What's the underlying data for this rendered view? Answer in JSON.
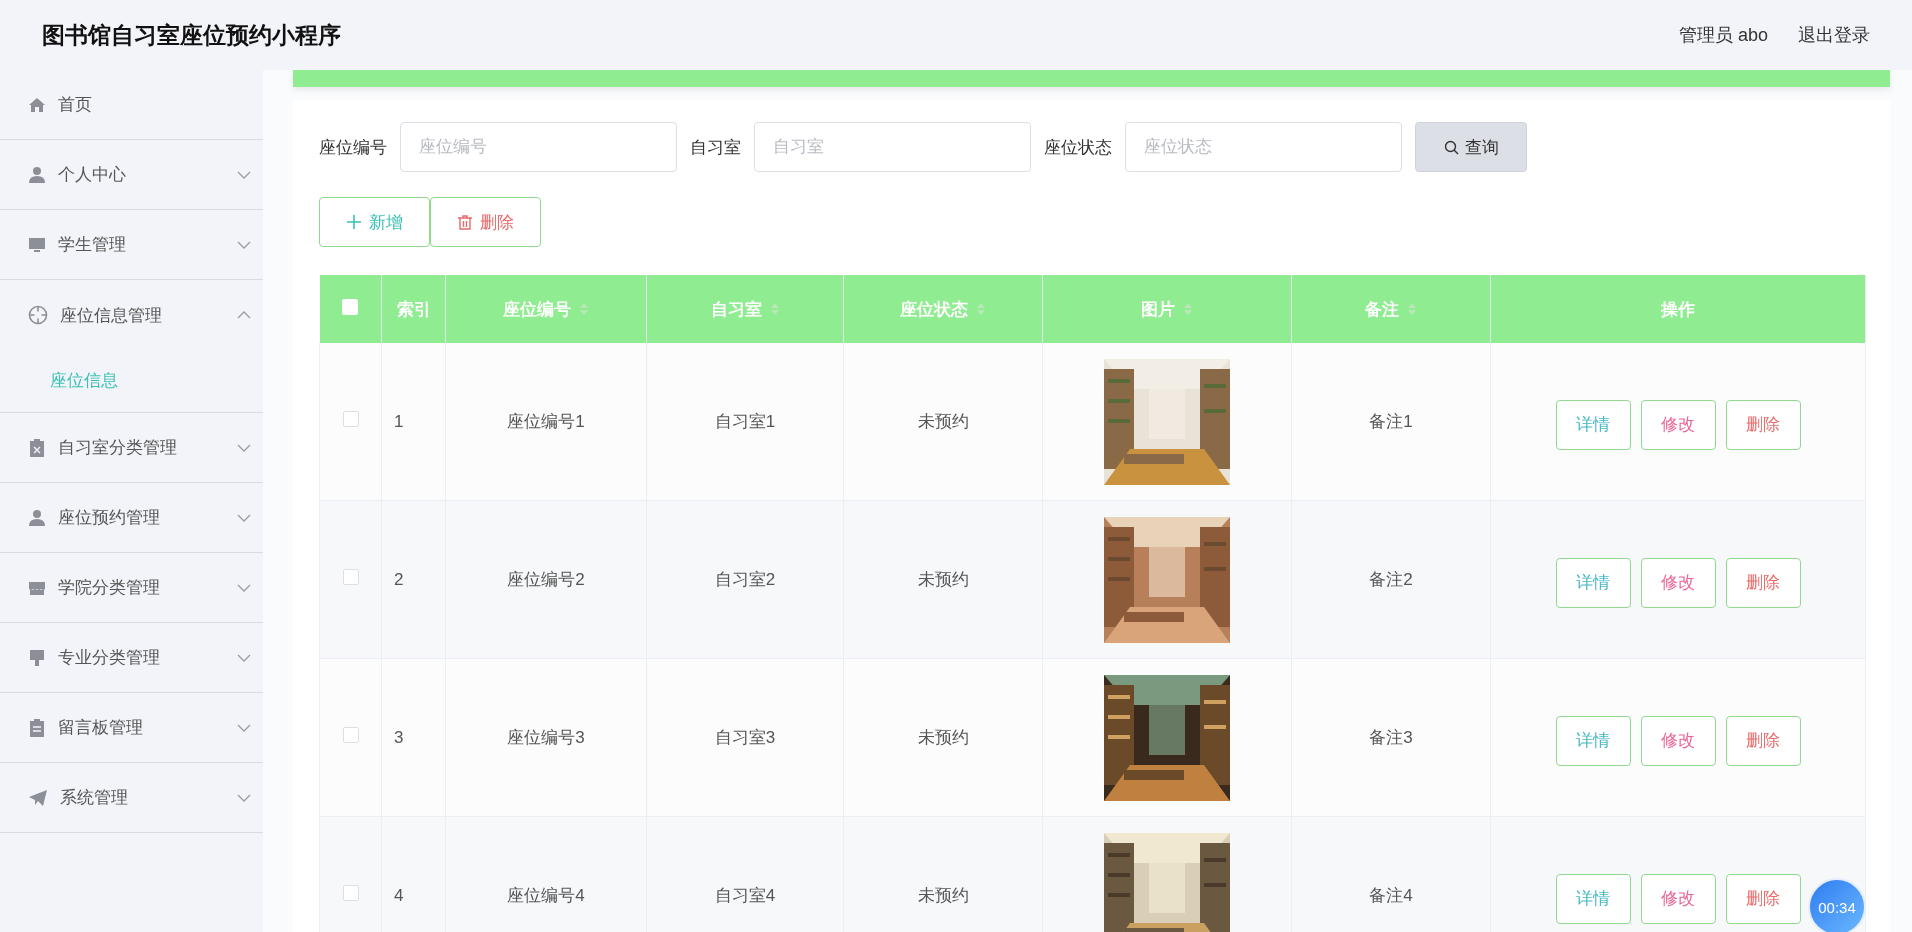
{
  "header": {
    "title": "图书馆自习室座位预约小程序",
    "user": "管理员 abo",
    "logout": "退出登录"
  },
  "sidebar": {
    "items": [
      {
        "label": "首页",
        "kind": "link"
      },
      {
        "label": "个人中心",
        "kind": "submenu",
        "expanded": false
      },
      {
        "label": "学生管理",
        "kind": "submenu",
        "expanded": false
      },
      {
        "label": "座位信息管理",
        "kind": "submenu",
        "expanded": true,
        "children": [
          {
            "label": "座位信息",
            "selected": true
          }
        ]
      },
      {
        "label": "自习室分类管理",
        "kind": "submenu",
        "expanded": false
      },
      {
        "label": "座位预约管理",
        "kind": "submenu",
        "expanded": false
      },
      {
        "label": "学院分类管理",
        "kind": "submenu",
        "expanded": false
      },
      {
        "label": "专业分类管理",
        "kind": "submenu",
        "expanded": false
      },
      {
        "label": "留言板管理",
        "kind": "submenu",
        "expanded": false
      },
      {
        "label": "系统管理",
        "kind": "submenu",
        "expanded": false
      }
    ]
  },
  "search": {
    "fields": [
      {
        "label": "座位编号",
        "placeholder": "座位编号"
      },
      {
        "label": "自习室",
        "placeholder": "自习室"
      },
      {
        "label": "座位状态",
        "placeholder": "座位状态"
      }
    ],
    "button": "查询"
  },
  "actions": [
    {
      "label": "新增",
      "kind": "add"
    },
    {
      "label": "删除",
      "kind": "delete"
    }
  ],
  "table": {
    "select_all": {
      "checked": false
    },
    "columns": [
      {
        "label": "索引",
        "sortable": false
      },
      {
        "label": "座位编号",
        "sortable": true
      },
      {
        "label": "自习室",
        "sortable": true
      },
      {
        "label": "座位状态",
        "sortable": true
      },
      {
        "label": "图片",
        "sortable": true
      },
      {
        "label": "备注",
        "sortable": true
      },
      {
        "label": "操作",
        "sortable": false
      }
    ],
    "rows": [
      {
        "checked": false,
        "index": "1",
        "seat_no": "座位编号1",
        "room": "自习室1",
        "status": "未预约",
        "picture": {
          "kind": "picture"
        },
        "note": "备注1",
        "actions": [
          {
            "label": "详情",
            "kind": "detail"
          },
          {
            "label": "修改",
            "kind": "edit"
          },
          {
            "label": "删除",
            "kind": "delete"
          }
        ]
      },
      {
        "checked": false,
        "index": "2",
        "seat_no": "座位编号2",
        "room": "自习室2",
        "status": "未预约",
        "picture": {
          "kind": "picture"
        },
        "note": "备注2",
        "actions": [
          {
            "label": "详情",
            "kind": "detail"
          },
          {
            "label": "修改",
            "kind": "edit"
          },
          {
            "label": "删除",
            "kind": "delete"
          }
        ]
      },
      {
        "checked": false,
        "index": "3",
        "seat_no": "座位编号3",
        "room": "自习室3",
        "status": "未预约",
        "picture": {
          "kind": "picture"
        },
        "note": "备注3",
        "actions": [
          {
            "label": "详情",
            "kind": "detail"
          },
          {
            "label": "修改",
            "kind": "edit"
          },
          {
            "label": "删除",
            "kind": "delete"
          }
        ]
      },
      {
        "checked": false,
        "index": "4",
        "seat_no": "座位编号4",
        "room": "自习室4",
        "status": "未预约",
        "picture": {
          "kind": "picture"
        },
        "note": "备注4",
        "actions": [
          {
            "label": "详情",
            "kind": "detail"
          },
          {
            "label": "修改",
            "kind": "edit"
          },
          {
            "label": "删除",
            "kind": "delete"
          }
        ]
      }
    ]
  },
  "timer": "00:34"
}
